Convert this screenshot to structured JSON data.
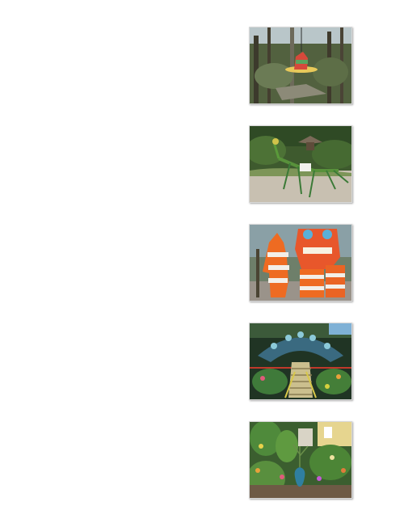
{
  "gallery": {
    "photos": [
      {
        "subject": "hanging-hat-sculpture-in-trees"
      },
      {
        "subject": "praying-mantis-sculpture"
      },
      {
        "subject": "traffic-barrel-creatures"
      },
      {
        "subject": "peacock-sculpture-garden-path"
      },
      {
        "subject": "flower-garden-with-vase"
      }
    ]
  }
}
